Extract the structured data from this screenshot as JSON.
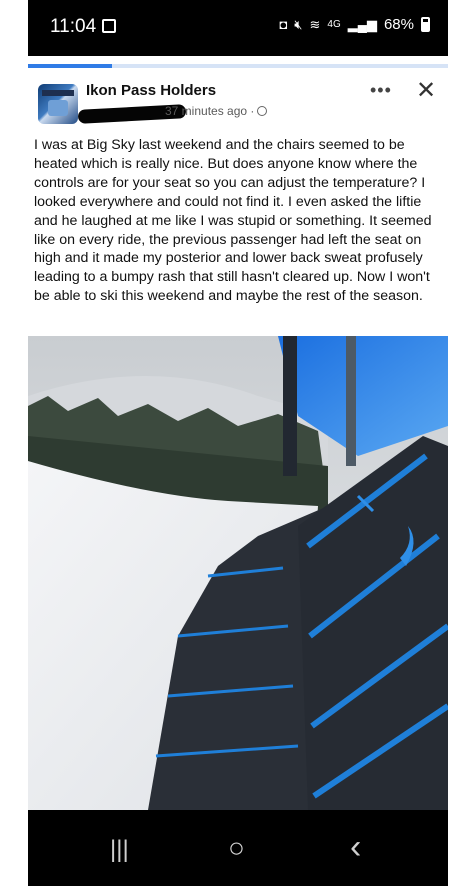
{
  "status_bar": {
    "time": "11:04",
    "network": "4G",
    "battery": "68%",
    "icons": [
      "image-icon",
      "shield-icon",
      "mute-icon",
      "wifi-icon",
      "signal-icon",
      "battery-icon"
    ]
  },
  "post": {
    "group_name": "Ikon Pass Holders",
    "timestamp": "37 minutes ago ·",
    "audience_icon": "globe-icon",
    "body": "I was at Big Sky last weekend and the chairs seemed to be heated which is really nice.  But does anyone know where the controls are for your seat so you can adjust the temperature?  I looked everywhere and could not find it.  I even asked the liftie and he laughed at me like I was stupid or something.  It seemed like on every ride, the previous passenger had left the seat on high and it made my posterior and lower back sweat profusely leading to a bumpy rash that still hasn't cleared up.  Now I won't be able to ski this weekend and maybe the rest of the season.",
    "more_label": "•••",
    "close_label": "✕"
  },
  "nav": {
    "recents": "|||",
    "home": "○",
    "back": "‹"
  },
  "colors": {
    "accent": "#2f7be6",
    "seat": "#262b33",
    "seat_trim": "#1f7fd8"
  }
}
